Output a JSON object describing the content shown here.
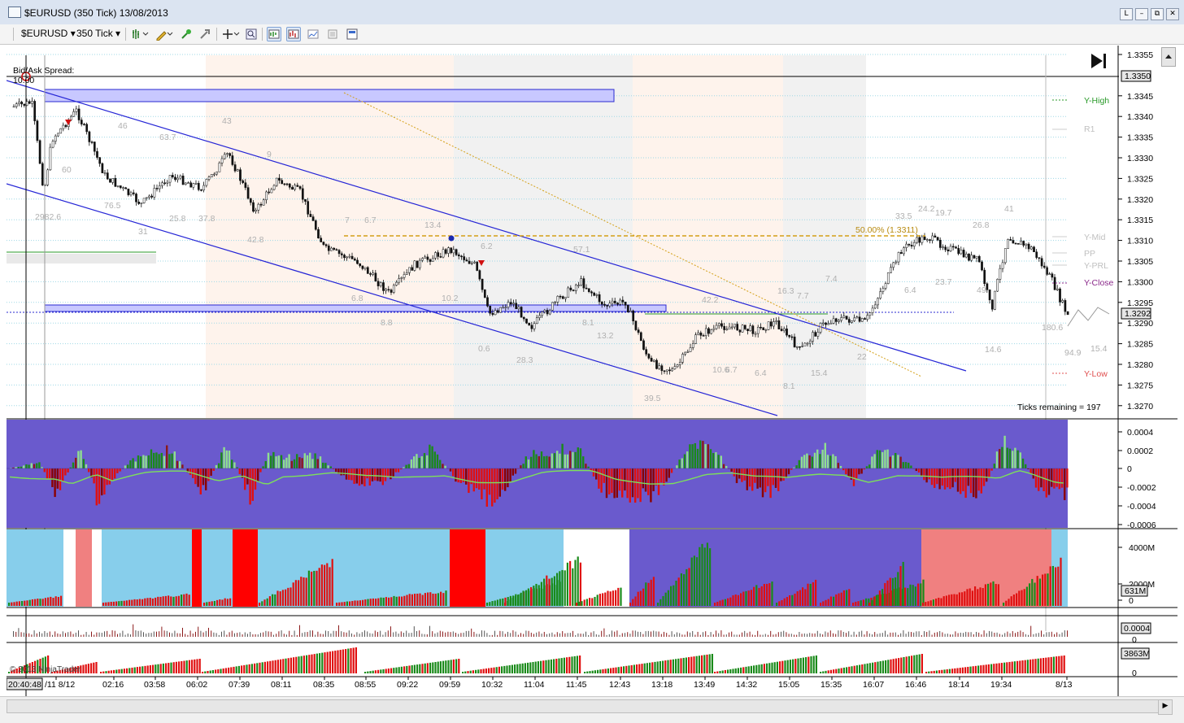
{
  "window": {
    "title": "$EURUSD (350 Tick)  13/08/2013",
    "buttons": [
      "L",
      "–",
      "⧉",
      "✕"
    ]
  },
  "toolbar": {
    "instrument": "$EURUSD",
    "interval": "350 Tick"
  },
  "overlay": {
    "spread_label": "Bid/Ask Spread:",
    "spread_value": "10.00",
    "ticks_remaining": "Ticks remaining = 197",
    "fib_label": "50.00% (1.3311)",
    "copyright": "© 2013 NinjaTrader"
  },
  "levels": {
    "y_high": "Y-High",
    "r1": "R1",
    "y_mid": "Y-Mid",
    "pp": "PP",
    "y_prl": "Y-PRL",
    "y_close": "Y-Close",
    "y_low": "Y-Low"
  },
  "price_axis": {
    "ticks": [
      "1.3355",
      "1.3345",
      "1.3340",
      "1.3335",
      "1.3330",
      "1.3325",
      "1.3320",
      "1.3315",
      "1.3310",
      "1.3305",
      "1.3300",
      "1.3295",
      "1.3290",
      "1.3285",
      "1.3280",
      "1.3275",
      "1.3270"
    ],
    "boxed_high": "1.3350",
    "boxed_last": "1.3292"
  },
  "osc_axis": {
    "ticks": [
      "0.0004",
      "0.0002",
      "0",
      "-0.0002",
      "-0.0004",
      "-0.0006"
    ]
  },
  "vol_axis": {
    "ticks": [
      "4000M",
      "2000M",
      "0"
    ],
    "boxed": "631M"
  },
  "panel3_axis": {
    "boxed": "0.0004",
    "zero": "0"
  },
  "panel4_axis": {
    "boxed": "3863M",
    "zero": "0"
  },
  "time_axis": {
    "first": "20:40:48",
    "labels": [
      "/11 8/12",
      "02:16",
      "03:58",
      "06:02",
      "07:39",
      "08:11",
      "08:35",
      "08:55",
      "09:22",
      "09:59",
      "10:32",
      "11:04",
      "11:45",
      "12:43",
      "13:18",
      "13:49",
      "14:32",
      "15:05",
      "15:35",
      "16:07",
      "16:46",
      "18:14",
      "19:34",
      "8/13"
    ]
  },
  "annotations": [
    "2982.6",
    "76.5",
    "31",
    "25.8",
    "37.8",
    "42.8",
    "60",
    "46",
    "63.7",
    "43",
    "9",
    "7",
    "6.7",
    "13.4",
    "6.8",
    "10.2",
    "8.8",
    "0.6",
    "28.3",
    "8.1",
    "13.2",
    "39.5",
    "6.2",
    "57.1",
    "42.2",
    "10.6",
    "6.7",
    "6.4",
    "16.3",
    "7.7",
    "7.4",
    "8.1",
    "15.4",
    "22",
    "33.5",
    "24.2",
    "19.7",
    "26.8",
    "41",
    "6.4",
    "23.7",
    "49",
    "14.6",
    "180.6",
    "94.9",
    "15.4"
  ],
  "colors": {
    "osc_bg": "#6a5acd",
    "up": "#1a8a1a",
    "light_up": "#8fe08f",
    "down": "#e01010",
    "dark_down": "#8b0000",
    "vol_blue": "#87ceeb",
    "vol_pink": "#f08080",
    "channel": "#2525d6",
    "fib": "#d4a017"
  }
}
